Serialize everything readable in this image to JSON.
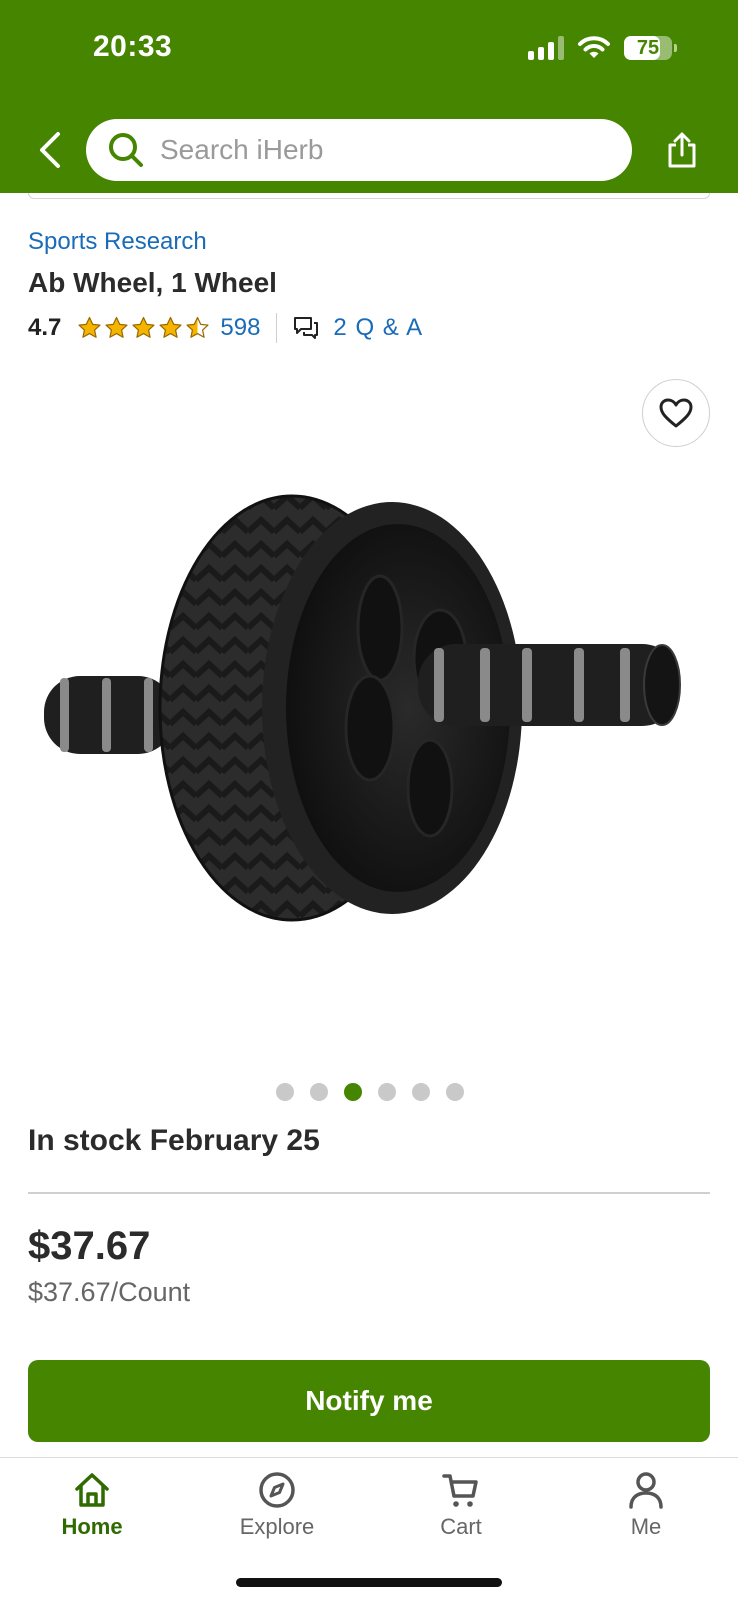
{
  "status_bar": {
    "time": "20:33",
    "battery": "75",
    "battery_level": 0.75
  },
  "header": {
    "search_placeholder": "Search iHerb",
    "icons": [
      "back-arrow-icon",
      "search-icon",
      "share-icon"
    ]
  },
  "product": {
    "brand": "Sports Research",
    "title": "Ab Wheel, 1 Wheel",
    "rating": "4.7",
    "rating_value": 4.7,
    "review_count": "598",
    "qa": "2 Q & A",
    "stock": "In stock February 25",
    "price": "$37.67",
    "unit_price": "$37.67/Count"
  },
  "gallery": {
    "total_images": 6,
    "active_index": 3
  },
  "actions": {
    "notify_label": "Notify me"
  },
  "tabbar": {
    "items": [
      {
        "label": "Home",
        "icon": "home-icon",
        "active": true
      },
      {
        "label": "Explore",
        "icon": "compass-icon",
        "active": false
      },
      {
        "label": "Cart",
        "icon": "cart-icon",
        "active": false
      },
      {
        "label": "Me",
        "icon": "person-icon",
        "active": false
      }
    ]
  },
  "colors": {
    "brand_green": "#458500",
    "link_blue": "#1a6bb8",
    "star_gold": "#f5b400"
  }
}
